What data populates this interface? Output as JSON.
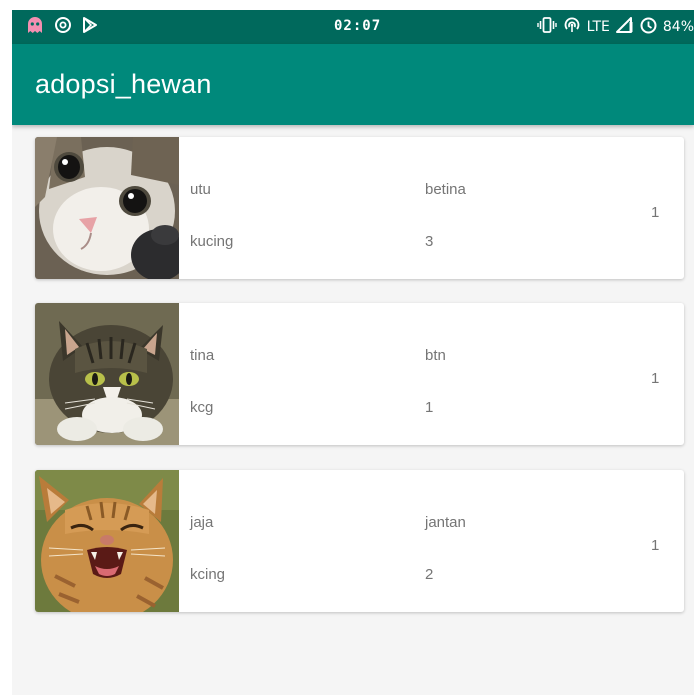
{
  "status_bar": {
    "time": "02:07",
    "network": "LTE",
    "battery": "84%",
    "icons": [
      "ghost-app-icon",
      "data-saver-icon",
      "play-store-icon",
      "vibrate-icon",
      "hotspot-icon",
      "signal-icon",
      "battery-saver-icon"
    ],
    "colors": {
      "background": "#00695c",
      "ghost": "#f48fb1"
    }
  },
  "app_bar": {
    "title": "adopsi_hewan",
    "color": "#00897b"
  },
  "pets": [
    {
      "name": "utu",
      "gender": "betina",
      "species": "kucing",
      "age": "3",
      "count": "1",
      "image": "kitten-closeup-photo"
    },
    {
      "name": "tina",
      "gender": "btn",
      "species": "kcg",
      "age": "1",
      "count": "1",
      "image": "tabby-cat-lying-photo"
    },
    {
      "name": "jaja",
      "gender": "jantan",
      "species": "kcing",
      "age": "2",
      "count": "1",
      "image": "orange-kitten-meowing-photo"
    }
  ]
}
